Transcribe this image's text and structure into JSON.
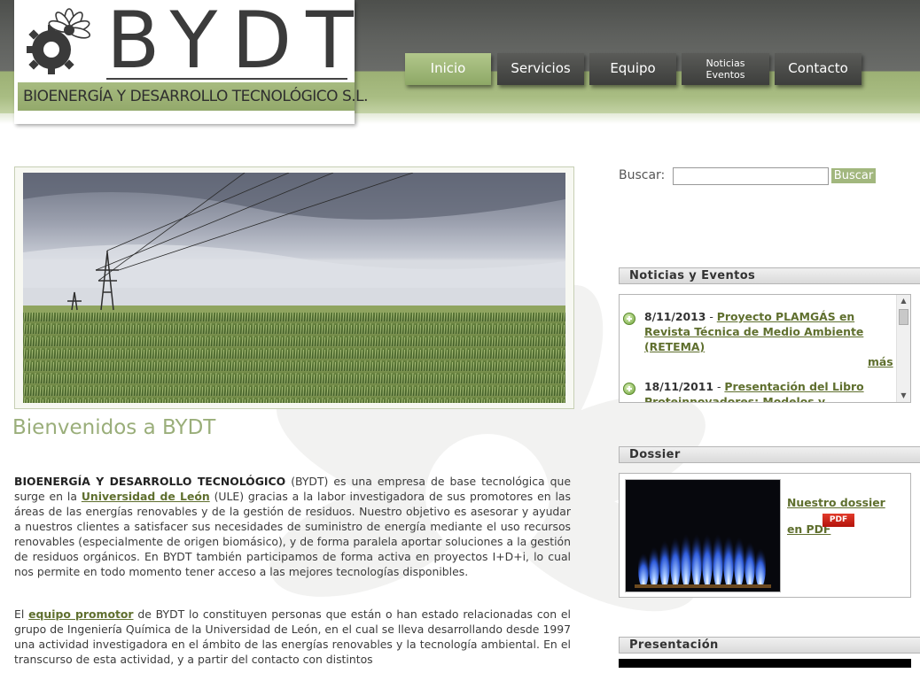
{
  "logo": {
    "letters": "BYDT",
    "subtitle": "BIOENERGÍA Y DESARROLLO TECNOLÓGICO S.L."
  },
  "nav": {
    "items": [
      {
        "label": "Inicio"
      },
      {
        "label": "Servicios"
      },
      {
        "label": "Equipo"
      },
      {
        "label_line1": "Noticias",
        "label_line2": "Eventos"
      },
      {
        "label": "Contacto"
      }
    ],
    "active": "Inicio"
  },
  "main": {
    "welcome_title": "Bienvenidos a BYDT",
    "p1": {
      "company": "BIOENERGÍA Y DESARROLLO TECNOLÓGICO",
      "t1": " (BYDT) es una empresa de base tecnológica que surge en la ",
      "link_uni": "Universidad de León",
      "t2": " (ULE) gracias a la labor investigadora de sus promotores en las áreas de las energías renovables y de la gestión de residuos. Nuestro objetivo es asesorar y ayudar a nuestros clientes a satisfacer sus necesidades de suministro de energía mediante el uso recursos renovables (especialmente de origen biomásico), y de forma paralela aportar soluciones a la gestión de residuos orgánicos. En BYDT también participamos de forma activa en proyectos I+D+i, lo cual nos permite en todo momento tener acceso a las mejores tecnologías disponibles."
    },
    "p2": {
      "t1": "El ",
      "link_team": "equipo promotor",
      "t2": " de BYDT lo constituyen personas que están o han estado relacionadas con el grupo de Ingeniería Química de la Universidad de León, en el cual se lleva desarrollando desde 1997 una actividad investigadora en el ámbito de las energías renovables y la tecnología ambiental. En el transcurso de esta actividad, y a partir del contacto con distintos"
    }
  },
  "search": {
    "label": "Buscar:",
    "value": "",
    "button": "Buscar"
  },
  "sidebar": {
    "news_title": "Noticias y Eventos",
    "news": [
      {
        "date": "8/11/2013",
        "sep": " - ",
        "title": "Proyecto PLAMGÁS en Revista Técnica de Medio Ambiente (RETEMA)",
        "more": "más"
      },
      {
        "date": "18/11/2011",
        "sep": " - ",
        "title": "Presentación del Libro Proteinnovadores: Modelos y Prototipos"
      }
    ],
    "dossier_title": "Dossier",
    "dossier_link": "Nuestro dossier en PDF",
    "pdf_icon_text": "PDF",
    "presentation_title": "Presentación"
  }
}
